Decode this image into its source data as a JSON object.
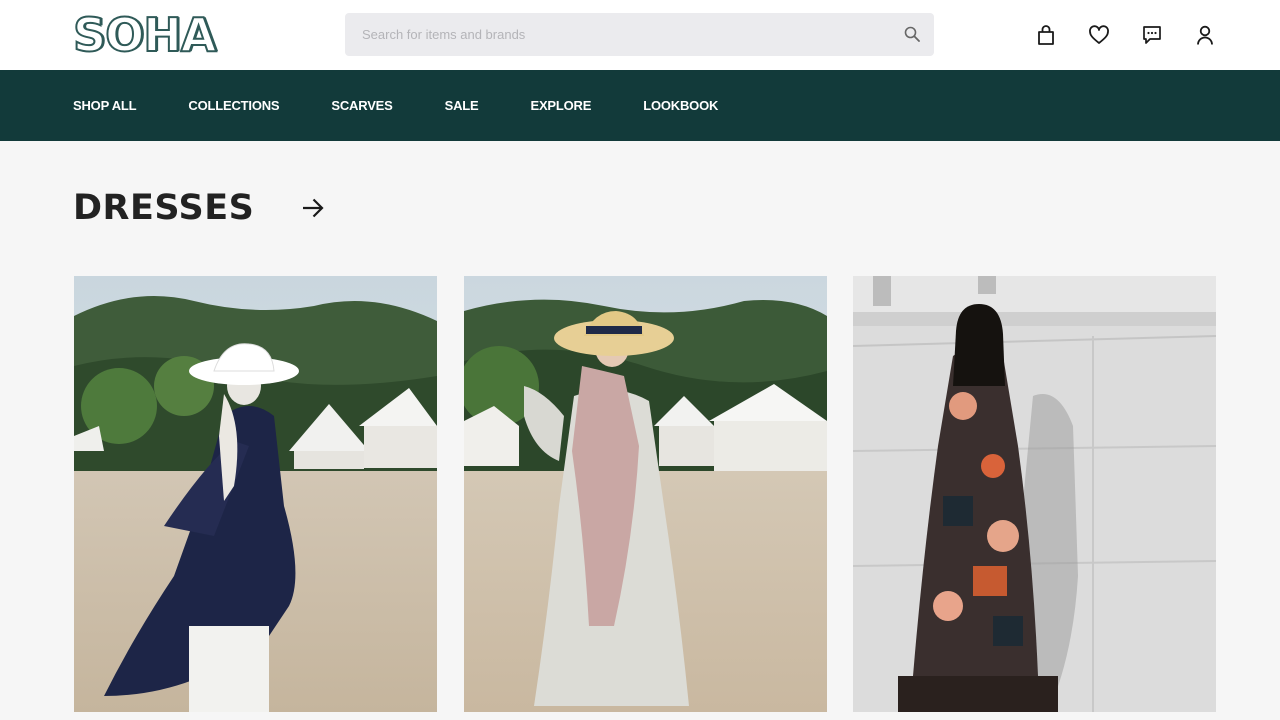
{
  "header": {
    "logo": "SOHA",
    "search_placeholder": "Search for items and brands",
    "icons": [
      "search-icon",
      "shopping-bag-icon",
      "heart-icon",
      "message-icon",
      "user-icon"
    ]
  },
  "nav": {
    "items": [
      {
        "label": "SHOP ALL"
      },
      {
        "label": "COLLECTIONS"
      },
      {
        "label": "SCARVES"
      },
      {
        "label": "SALE"
      },
      {
        "label": "EXPLORE"
      },
      {
        "label": "LOOKBOOK"
      }
    ]
  },
  "section": {
    "title": "DRESSES",
    "arrow_icon": "arrow-right-icon"
  },
  "products": [
    {
      "image": "navy sheer dress with white hat at campsite"
    },
    {
      "image": "white printed shirt dress with straw hat and pink scarf"
    },
    {
      "image": "geometric print maxi dress by stone wall"
    }
  ],
  "colors": {
    "nav_bg": "#123a3a",
    "logo": "#2f5a58",
    "page_bg": "#f6f6f6",
    "search_bg": "#ebebee"
  }
}
